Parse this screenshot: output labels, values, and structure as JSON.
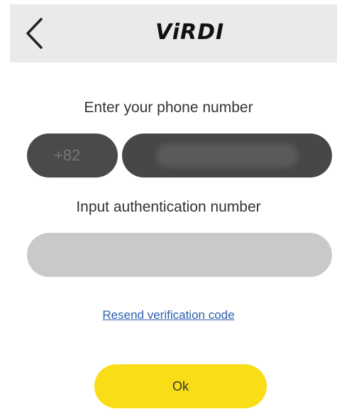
{
  "header": {
    "back_icon": "chevron-left-icon",
    "logo_text": "ViRDI"
  },
  "phone": {
    "label": "Enter your phone number",
    "country_code": "+82",
    "number_value": ""
  },
  "auth": {
    "label": "Input authentication number",
    "value": ""
  },
  "resend_link": "Resend verification code",
  "ok_button": "Ok",
  "colors": {
    "header_bg": "#eaeaea",
    "dark_input_bg": "#4a4a4a",
    "light_input_bg": "#c9c9c9",
    "link": "#2d5db0",
    "ok_button": "#f9dd17"
  }
}
